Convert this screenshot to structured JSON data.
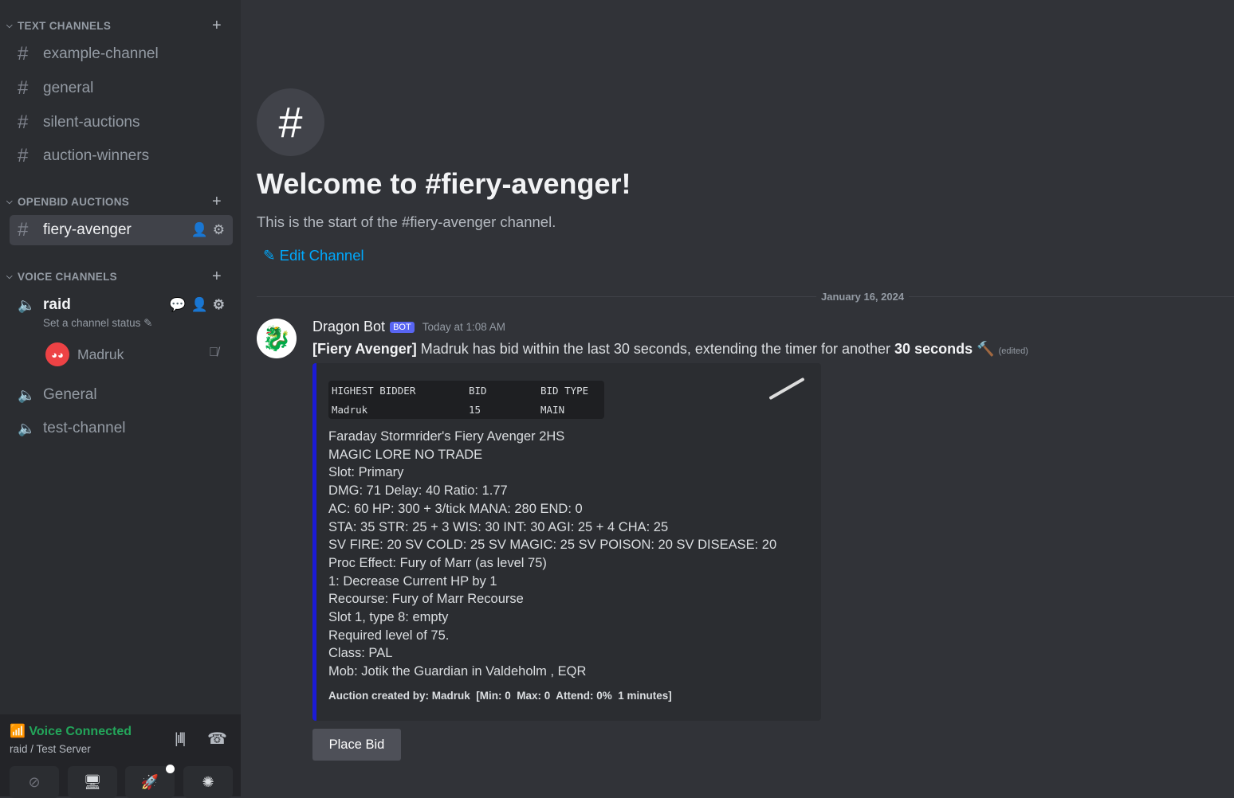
{
  "sidebar": {
    "text_channels_label": "TEXT CHANNELS",
    "text_channels": [
      "example-channel",
      "general",
      "silent-auctions",
      "auction-winners"
    ],
    "openbid_label": "OPENBID AUCTIONS",
    "openbid_channels": [
      "fiery-avenger"
    ],
    "voice_label": "VOICE CHANNELS",
    "voice_channels": {
      "raid": "raid",
      "raid_status": "Set a channel status",
      "member": "Madruk",
      "general": "General",
      "test": "test-channel"
    },
    "voice_panel": {
      "status": "Voice Connected",
      "location": "raid / Test Server"
    }
  },
  "main": {
    "welcome_title": "Welcome to #fiery-avenger!",
    "welcome_sub": "This is the start of the #fiery-avenger channel.",
    "edit_channel": "Edit Channel",
    "date_divider": "January 16, 2024",
    "message": {
      "author": "Dragon Bot",
      "badge": "BOT",
      "timestamp": "Today at 1:08 AM",
      "prefix": "[Fiery Avenger]",
      "text": " Madruk has bid within the last 30 seconds, extending the timer for another ",
      "bold": "30 seconds",
      "edited": "(edited)",
      "table": {
        "headers": [
          "HIGHEST BIDDER",
          "BID",
          "BID TYPE"
        ],
        "row": [
          "Madruk",
          "15",
          "MAIN"
        ]
      },
      "lines": [
        "Faraday Stormrider's Fiery Avenger 2HS",
        "MAGIC LORE NO TRADE",
        "Slot: Primary",
        "DMG: 71 Delay: 40 Ratio: 1.77",
        "AC: 60 HP: 300 + 3/tick MANA: 280 END: 0",
        "STA: 35 STR: 25 + 3 WIS: 30 INT: 30 AGI: 25 + 4 CHA: 25",
        "SV FIRE: 20 SV COLD: 25 SV MAGIC: 25 SV POISON: 20 SV DISEASE: 20",
        "Proc Effect: Fury of Marr (as level 75)",
        "1: Decrease Current HP by 1",
        "Recourse: Fury of Marr Recourse",
        "Slot 1, type 8: empty",
        "Required level of 75.",
        "Class: PAL",
        "Mob: Jotik the Guardian in Valdeholm , EQR"
      ],
      "footer": "Auction created by: Madruk  [Min: 0  Max: 0  Attend: 0%  1 minutes]",
      "button": "Place Bid"
    }
  },
  "colors": {
    "accent": "#00a8fc",
    "green": "#23a55a",
    "embed_bar": "#1b1bd6",
    "badge": "#5865f2"
  }
}
